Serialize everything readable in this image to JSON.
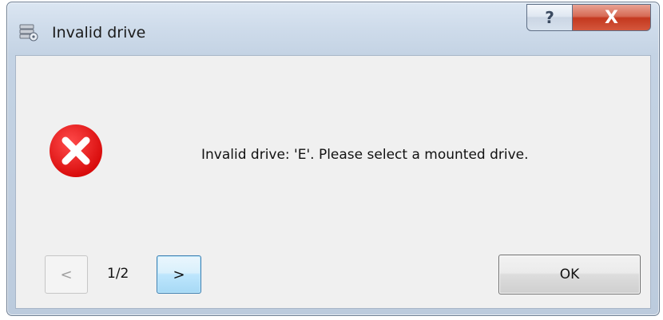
{
  "window": {
    "title": "Invalid drive",
    "help_label": "?",
    "close_label": "X"
  },
  "dialog": {
    "message": "Invalid drive: 'E'. Please select a mounted drive.",
    "prev_label": "<",
    "page_indicator": "1/2",
    "next_label": ">",
    "ok_label": "OK"
  },
  "icons": {
    "title": "drive-icon",
    "message": "error-icon"
  },
  "colors": {
    "error_red": "#e51a1a",
    "close_button": "#c4391f",
    "focus_border": "#3c7fb1"
  }
}
